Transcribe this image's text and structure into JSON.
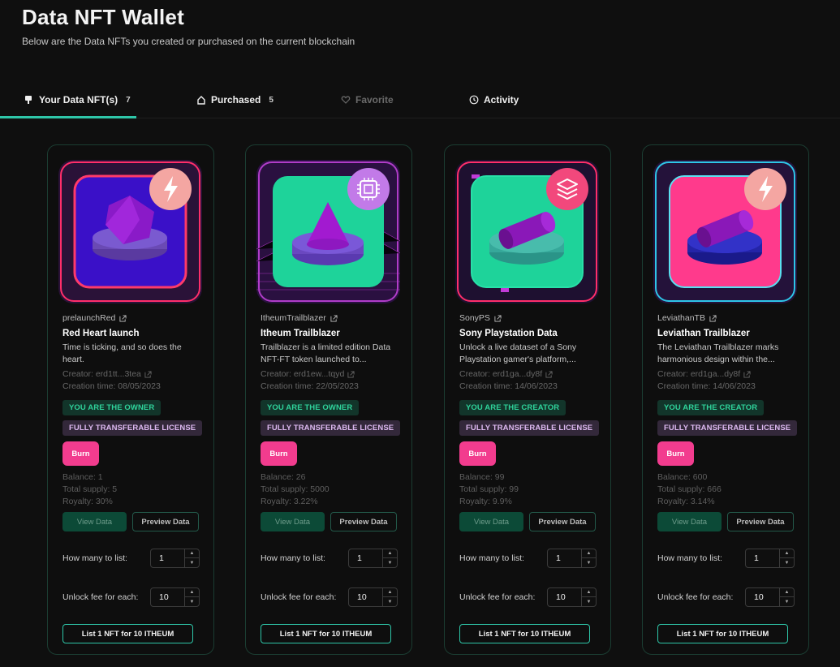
{
  "header": {
    "title": "Data NFT Wallet",
    "subtitle": "Below are the Data NFTs you created or purchased on the current blockchain"
  },
  "tabs": [
    {
      "label": "Your Data NFT(s)",
      "count": "7",
      "icon": "wallet-icon"
    },
    {
      "label": "Purchased",
      "count": "5",
      "icon": "home-icon"
    },
    {
      "label": "Favorite",
      "count": "",
      "icon": "heart-icon"
    },
    {
      "label": "Activity",
      "count": "",
      "icon": "clock-icon"
    }
  ],
  "colors": {
    "accent": "#2ec6a8",
    "burn": "#f23c8e",
    "owner_badge_text": "#2fd39b",
    "license_badge_text": "#dcb8f0"
  },
  "cards": [
    {
      "handle": "prelaunchRed",
      "title": "Red Heart launch",
      "desc_line1": "Time is ticking, and so does the",
      "desc_line2": "heart.",
      "creator": "Creator: erd1tt...3tea",
      "creation_time": "Creation time: 08/05/2023",
      "role_badge": "YOU ARE THE OWNER",
      "license_badge": "FULLY TRANSFERABLE LICENSE",
      "burn_label": "Burn",
      "balance": "Balance: 1",
      "total_supply": "Total supply: 5",
      "royalty": "Royalty: 30%",
      "view_label": "View Data",
      "preview_label": "Preview Data",
      "list_qty_label": "How many to list:",
      "list_qty_value": "1",
      "fee_label": "Unlock fee for each:",
      "fee_value": "10",
      "list_button": "List 1 NFT for 10 ITHEUM",
      "art": {
        "bg": "#3a10c8",
        "frame": "#ff2e6a",
        "shape": "d20",
        "badge_icon": "lightning-icon",
        "badge_color": "#f4a6a2"
      }
    },
    {
      "handle": "ItheumTrailblazer",
      "title": "Itheum Trailblazer",
      "desc_line1": "Trailblazer is a limited edition Data",
      "desc_line2": "NFT-FT token launched to...",
      "creator": "Creator: erd1ew...tqyd",
      "creation_time": "Creation time: 22/05/2023",
      "role_badge": "YOU ARE THE OWNER",
      "license_badge": "FULLY TRANSFERABLE LICENSE",
      "burn_label": "Burn",
      "balance": "Balance: 26",
      "total_supply": "Total supply: 5000",
      "royalty": "Royalty: 3.22%",
      "view_label": "View Data",
      "preview_label": "Preview Data",
      "list_qty_label": "How many to list:",
      "list_qty_value": "1",
      "fee_label": "Unlock fee for each:",
      "fee_value": "10",
      "list_button": "List 1 NFT for 10 ITHEUM",
      "art": {
        "bg": "#1ed39a",
        "frame": "#b03cc8",
        "shape": "cone",
        "badge_icon": "chip-icon",
        "badge_color": "#c27ae8"
      }
    },
    {
      "handle": "SonyPS",
      "title": "Sony Playstation Data",
      "desc_line1": "Unlock a live dataset of a Sony",
      "desc_line2": "Playstation gamer's platform,...",
      "creator": "Creator: erd1ga...dy8f",
      "creation_time": "Creation time: 14/06/2023",
      "role_badge": "YOU ARE THE CREATOR",
      "license_badge": "FULLY TRANSFERABLE LICENSE",
      "burn_label": "Burn",
      "balance": "Balance: 99",
      "total_supply": "Total supply: 99",
      "royalty": "Royalty: 9.9%",
      "view_label": "View Data",
      "preview_label": "Preview Data",
      "list_qty_label": "How many to list:",
      "list_qty_value": "1",
      "fee_label": "Unlock fee for each:",
      "fee_value": "10",
      "list_button": "List 1 NFT for 10 ITHEUM",
      "art": {
        "bg": "#1ed39a",
        "frame": "#ff2e6a",
        "shape": "cylinder",
        "badge_icon": "layers-icon",
        "badge_color": "#f2487c"
      }
    },
    {
      "handle": "LeviathanTB",
      "title": "Leviathan Trailblazer",
      "desc_line1": "The Leviathan Trailblazer marks",
      "desc_line2": "harmonious design within the...",
      "creator": "Creator: erd1ga...dy8f",
      "creation_time": "Creation time: 14/06/2023",
      "role_badge": "YOU ARE THE CREATOR",
      "license_badge": "FULLY TRANSFERABLE LICENSE",
      "burn_label": "Burn",
      "balance": "Balance: 600",
      "total_supply": "Total supply: 666",
      "royalty": "Royalty: 3.14%",
      "view_label": "View Data",
      "preview_label": "Preview Data",
      "list_qty_label": "How many to list:",
      "list_qty_value": "1",
      "fee_label": "Unlock fee for each:",
      "fee_value": "10",
      "list_button": "List 1 NFT for 10 ITHEUM",
      "art": {
        "bg": "#ff3a8c",
        "frame": "#2ec6e8",
        "shape": "cylinder-blue",
        "badge_icon": "lightning-icon",
        "badge_color": "#f4a6a2"
      }
    }
  ]
}
